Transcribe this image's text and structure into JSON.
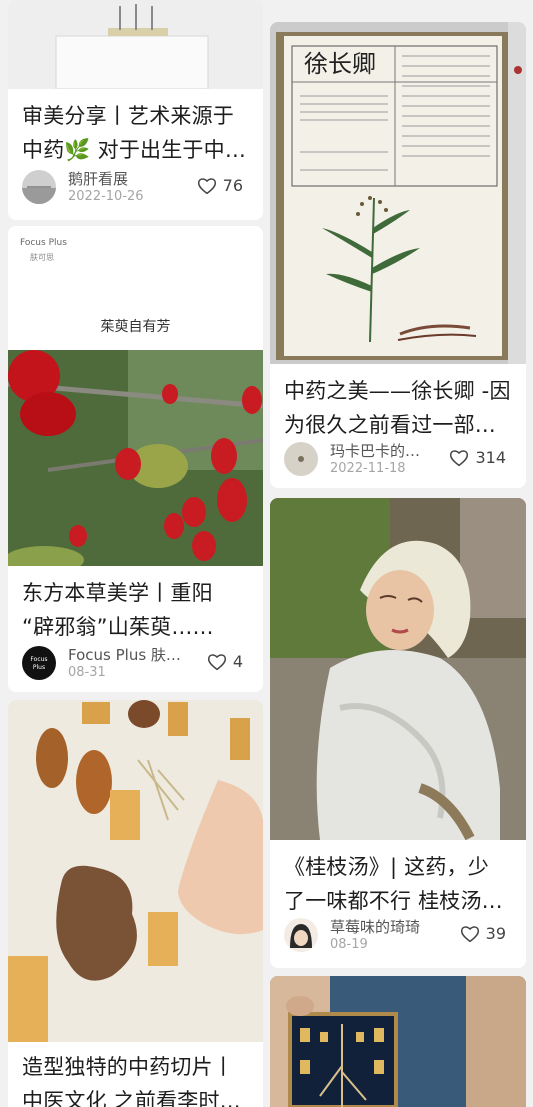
{
  "feed": {
    "cards": [
      {
        "title": "审美分享丨艺术来源于\n中药🌿 对于出生于中…",
        "author": "鹅肝看展",
        "date": "2022-10-26",
        "likes": "76",
        "image": "museum-display-photo"
      },
      {
        "title": "中药之美——徐长卿 -因\n为很久之前看过一部…",
        "author": "玛卡巴卡的…",
        "date": "2022-11-18",
        "likes": "314",
        "image": "herbal-book-illustration-photo",
        "book_heading": "徐长卿"
      },
      {
        "title": "东方本草美学丨重阳\n“辟邪翁”山茱萸……",
        "author": "Focus Plus 肤…",
        "date": "08-31",
        "likes": "4",
        "image": "cornus-berries-photo",
        "brand": "Focus Plus",
        "brand_sub": "肤可思",
        "subtitle": "茱萸自有芳",
        "avatar_text": "Focus Plus"
      },
      {
        "title": "《桂枝汤》| 这药，少\n了一味都不行 桂枝汤…",
        "author": "草莓味的琦琦",
        "date": "08-19",
        "likes": "39",
        "image": "costume-portrait-photo"
      },
      {
        "title": "造型独特的中药切片丨\n中医文化 之前看李时…",
        "image": "herb-slices-photo"
      },
      {
        "image": "herb-frame-artwork-photo"
      }
    ]
  },
  "colors": {
    "background": "#f1f1f1",
    "card": "#ffffff",
    "text": "#1d1d1d",
    "meta": "#a5a5a5"
  }
}
